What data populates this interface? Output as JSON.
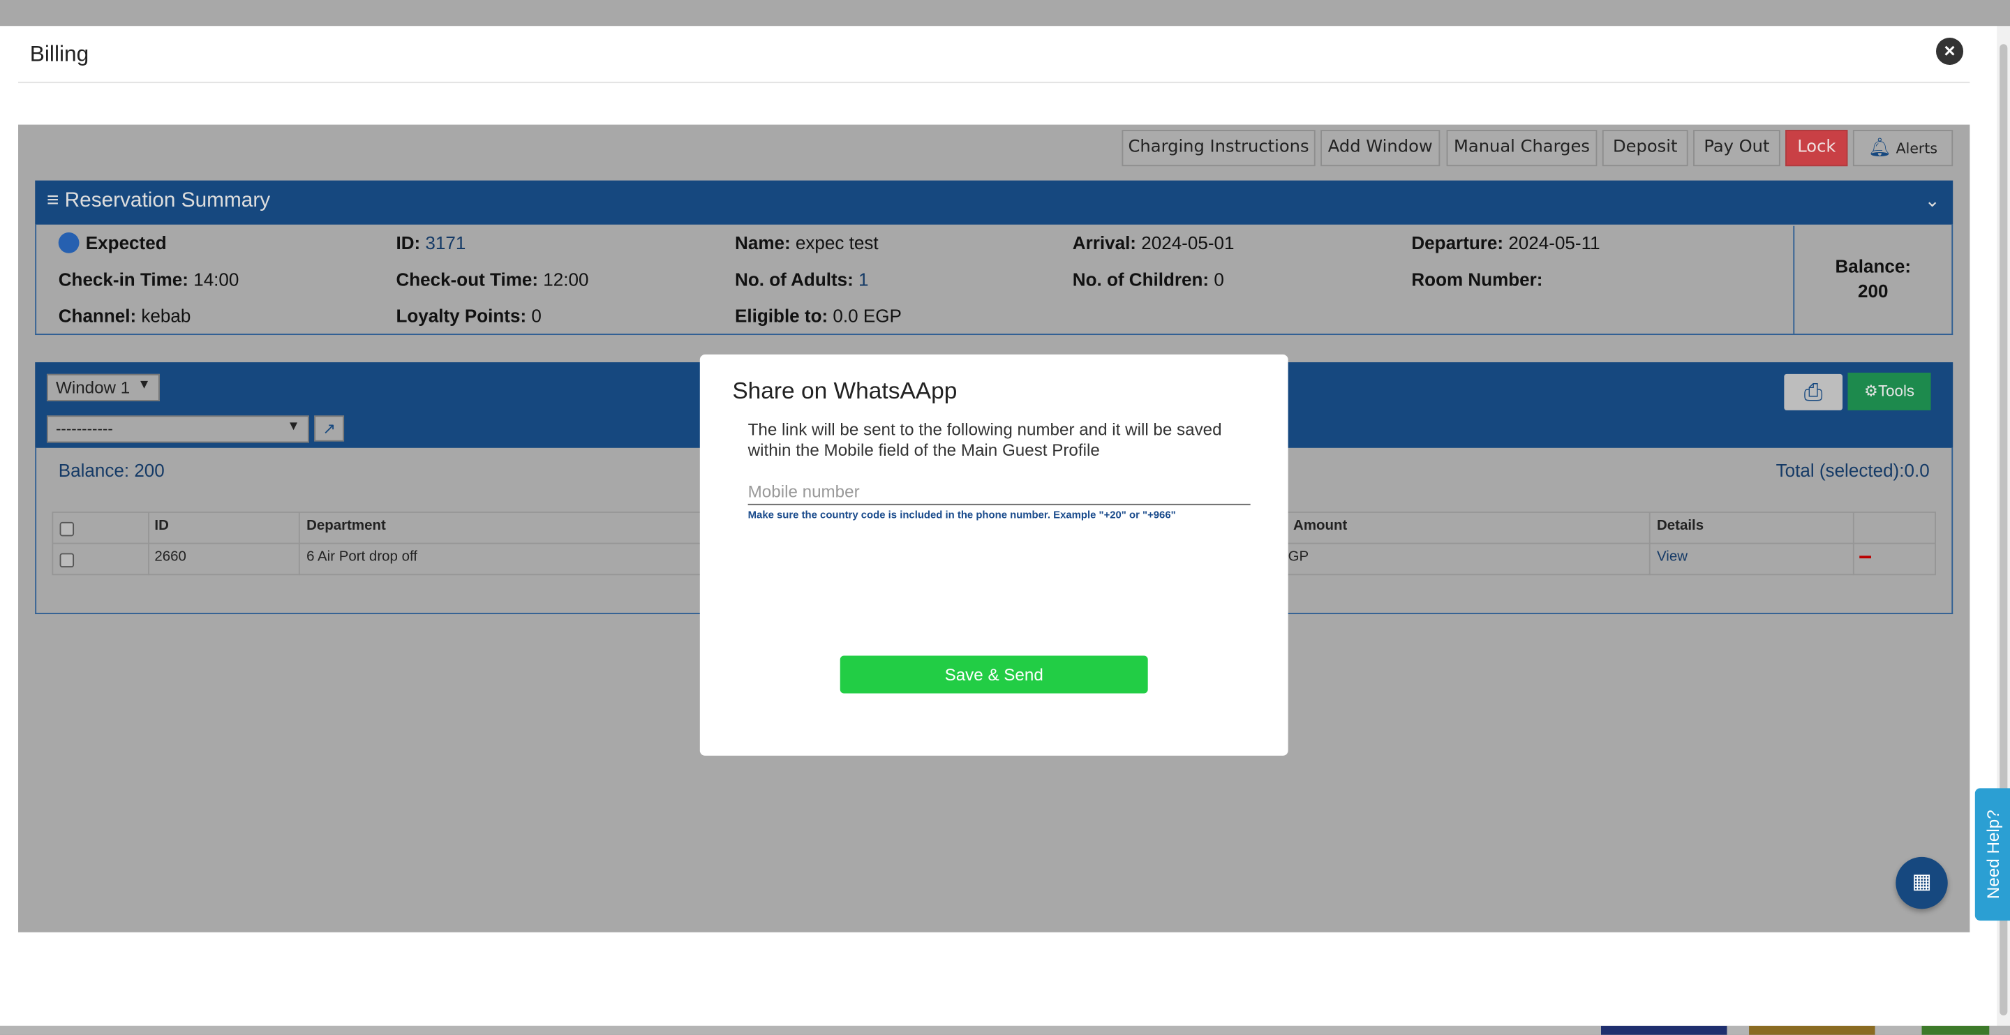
{
  "billing": {
    "title": "Billing",
    "close_icon": "×"
  },
  "toolbar": {
    "charging_instructions": "Charging Instructions",
    "add_window": "Add Window",
    "manual_charges": "Manual Charges",
    "deposit": "Deposit",
    "pay_out": "Pay Out",
    "lock": "Lock",
    "alerts": "Alerts"
  },
  "summary": {
    "title": "Reservation Summary",
    "status": "Expected",
    "id_label": "ID:",
    "id_value": "3171",
    "name_label": "Name:",
    "name_value": "expec test",
    "arrival_label": "Arrival:",
    "arrival_value": "2024-05-01",
    "departure_label": "Departure:",
    "departure_value": "2024-05-11",
    "checkin_label": "Check-in Time:",
    "checkin_value": "14:00",
    "checkout_label": "Check-out Time:",
    "checkout_value": "12:00",
    "adults_label": "No. of Adults:",
    "adults_value": "1",
    "children_label": "No. of Children:",
    "children_value": "0",
    "room_label": "Room Number:",
    "room_value": "",
    "channel_label": "Channel:",
    "channel_value": "kebab",
    "loyalty_label": "Loyalty Points:",
    "loyalty_value": "0",
    "eligible_label": "Eligible to:",
    "eligible_value": "0.0 EGP",
    "balance_label": "Balance:",
    "balance_value": "200"
  },
  "window": {
    "selected": "Window 1",
    "filter_selected": "-----------",
    "tools_label": "Tools",
    "balance_text": "Balance: 200",
    "total_text": "Total (selected):0.0"
  },
  "table": {
    "headers": {
      "id": "ID",
      "department": "Department",
      "amount": "Amount",
      "details": "Details"
    },
    "rows": [
      {
        "id": "2660",
        "department": "6 Air Port drop off",
        "amount_partial": "GP",
        "details": "View"
      }
    ]
  },
  "whatsapp": {
    "title": "Share on WhatsAApp",
    "description": "The link will be sent to the following number and it will be saved within the Mobile field of the Main Guest Profile",
    "mobile_placeholder": "Mobile number",
    "mobile_value": "",
    "hint": "Make sure the country code is included in the phone number. Example \"+20\" or \"+966\"",
    "send_label": "Save & Send"
  },
  "help": {
    "label": "Need Help?"
  },
  "colors": {
    "primary": "#16487f",
    "whatsapp_green": "#22cd45",
    "lock_red": "#c94045",
    "help_blue": "#2b9fd3"
  }
}
